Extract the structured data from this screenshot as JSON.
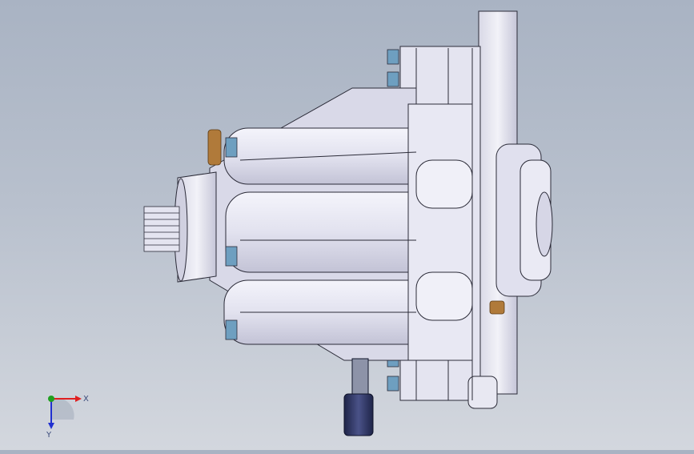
{
  "viewport": {
    "colors": {
      "background_top": "#a9b3c3",
      "background_bottom": "#d3d7de",
      "part_face": "#e6e6f2",
      "part_shade": "#c9c9dc",
      "edge": "#2b2b38",
      "fastener": "#6e9fc0",
      "knob": "#2f3660",
      "bronze": "#b07a3a"
    },
    "model": "pump-assembly"
  },
  "triad": {
    "x_label": "X",
    "y_label": "Y",
    "x_color": "#e02020",
    "y_color": "#2030d0",
    "z_color": "#20a020"
  }
}
